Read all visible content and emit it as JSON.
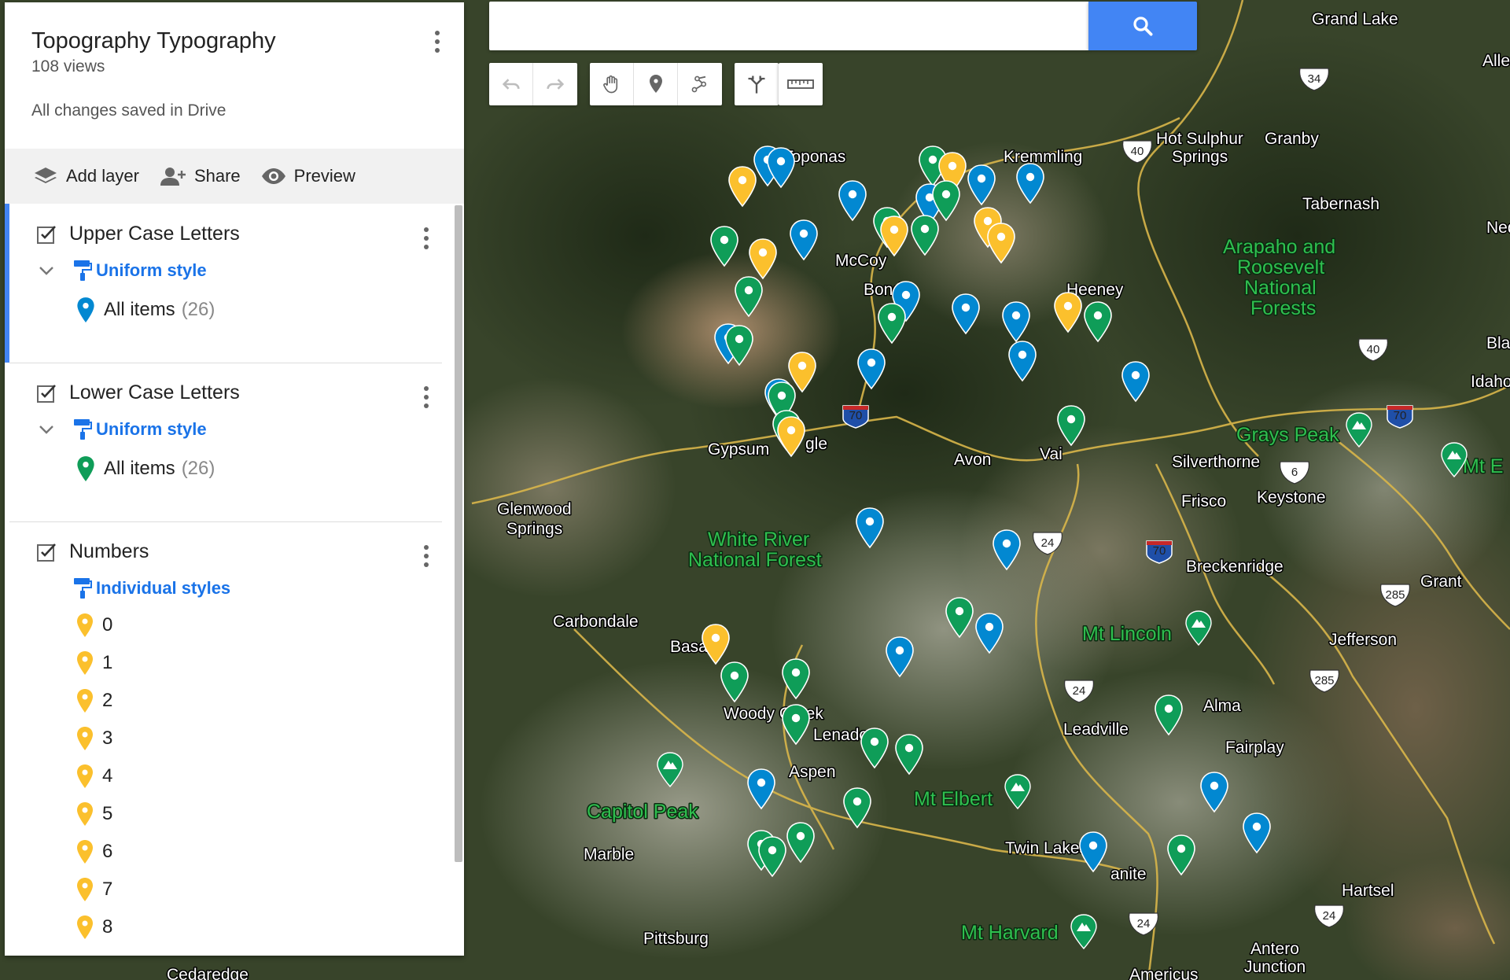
{
  "map_panel": {
    "title": "Topography Typography",
    "views": "108 views",
    "save_status": "All changes saved in Drive"
  },
  "actions": {
    "add_layer": "Add layer",
    "share": "Share",
    "preview": "Preview"
  },
  "layers": [
    {
      "name": "Upper Case Letters",
      "style": "Uniform style",
      "items_label": "All items",
      "items_count": "(26)",
      "color": "#0288d1"
    },
    {
      "name": "Lower Case Letters",
      "style": "Uniform style",
      "items_label": "All items",
      "items_count": "(26)",
      "color": "#0f9d58"
    },
    {
      "name": "Numbers",
      "style": "Individual styles",
      "items": [
        "0",
        "1",
        "2",
        "3",
        "4",
        "5",
        "6",
        "7",
        "8"
      ],
      "color": "#fbc02d"
    }
  ],
  "search": {
    "value": ""
  },
  "map_labels": {
    "places": [
      "Grand Lake",
      "Allen",
      "Toponas",
      "Kremmling",
      "Hot Sulphur",
      "Springs",
      "Granby",
      "Tabernash",
      "Ned",
      "McCoy",
      "Bond",
      "Heeney",
      "Bla",
      "Idaho",
      "Gypsum",
      "gle",
      "Avon",
      "Vai",
      "Silverthorne",
      "Frisco",
      "Keystone",
      "Glenwood",
      "Springs",
      "Breckenridge",
      "Grant",
      "Carbondale",
      "Jefferson",
      "Basa",
      "Woody Creek",
      "Lenado",
      "Alma",
      "Leadville",
      "Fairplay",
      "Aspen",
      "Marble",
      "Twin Lakes",
      "anite",
      "Hartsel",
      "Pittsburg",
      "Antero",
      "Junction",
      "Cedaredge",
      "Americus"
    ],
    "features": [
      "Arapaho and",
      "Roosevelt",
      "National",
      "Forests",
      "Grays Peak",
      "Mt E",
      "White River",
      "National Forest",
      "Mt Lincoln",
      "Capitol Peak",
      "Mt Elbert",
      "Mt Harvard"
    ],
    "shields": [
      "34",
      "40",
      "40",
      "70",
      "70",
      "6",
      "24",
      "70",
      "285",
      "24",
      "285",
      "24",
      "24"
    ]
  },
  "colors": {
    "pin_blue": "#0288d1",
    "pin_green": "#0f9d58",
    "pin_yellow": "#fbc02d",
    "link_blue": "#1a73e8",
    "search_blue": "#4285f4"
  },
  "icons": [
    "search-icon",
    "undo-icon",
    "redo-icon",
    "hand-icon",
    "marker-icon",
    "line-icon",
    "directions-icon",
    "ruler-icon",
    "layers-icon",
    "add-person-icon",
    "eye-icon",
    "paint-roller-icon",
    "checkbox-icon",
    "chevron-down-icon",
    "more-vert-icon"
  ]
}
